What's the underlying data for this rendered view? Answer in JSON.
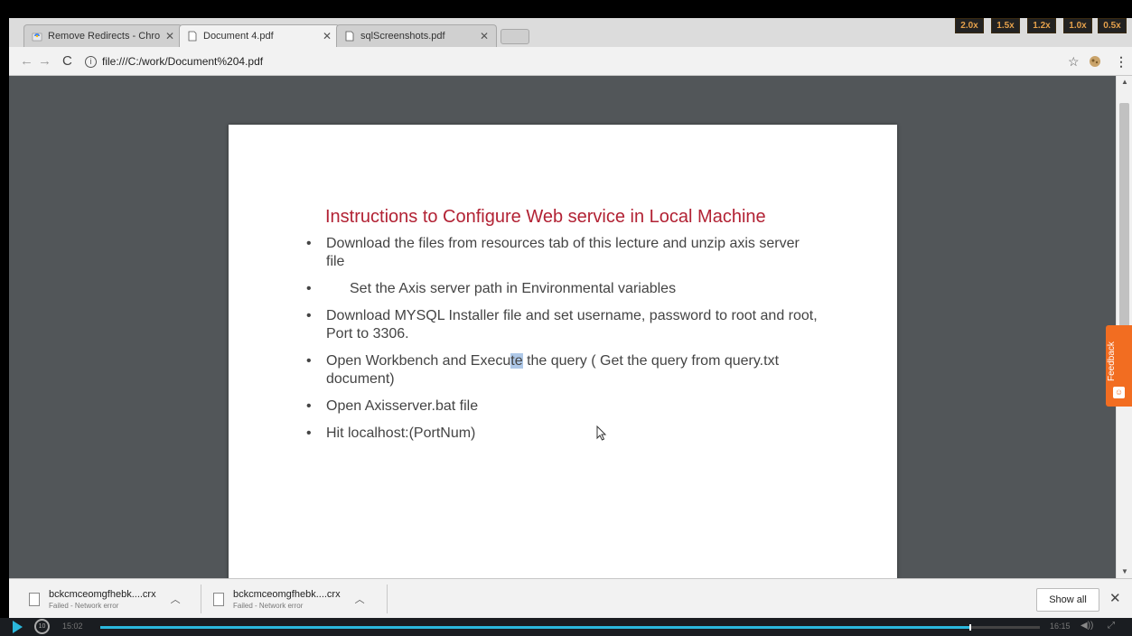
{
  "tabs": [
    {
      "label": "Remove Redirects - Chro",
      "active": false,
      "icon": "chrome-store-icon"
    },
    {
      "label": "Document 4.pdf",
      "active": true,
      "icon": "document-icon"
    },
    {
      "label": "sqlScreenshots.pdf",
      "active": false,
      "icon": "document-icon"
    }
  ],
  "tab_close": "✕",
  "speeds": [
    "2.0x",
    "1.5x",
    "1.2x",
    "1.0x",
    "0.5x"
  ],
  "address": {
    "url": "file:///C:/work/Document%204.pdf"
  },
  "document": {
    "title": "Instructions to Configure Web service in Local Machine",
    "bullets": [
      "Download the files from resources tab of this lecture and unzip axis server file",
      "Set the Axis server path in Environmental variables",
      "Download MYSQL Installer file and set username, password to root and root, Port to 3306.",
      "Open Workbench and Execute the query ( Get the query from query.txt document)",
      "Open Axisserver.bat file",
      "Hit localhost:(PortNum)"
    ],
    "highlight_segments": {
      "before": "Open Workbench and Execu",
      "highlight": "te",
      "after": " the query ( Get the query from query.txt document)"
    }
  },
  "feedback": {
    "label": "Feedback"
  },
  "downloads": {
    "items": [
      {
        "name": "bckcmceomgfhebk....crx",
        "status": "Failed - Network error"
      },
      {
        "name": "bckcmceomgfhebk....crx",
        "status": "Failed - Network error"
      }
    ],
    "show_all_label": "Show all",
    "close": "✕"
  },
  "player": {
    "current_time": "15:02",
    "total_time": "16:15",
    "progress": 0.925
  },
  "colors": {
    "accent": "#2bb8dc",
    "title_red": "#b22234",
    "feedback_orange": "#f26d21",
    "speed_text": "#e4a04b"
  }
}
